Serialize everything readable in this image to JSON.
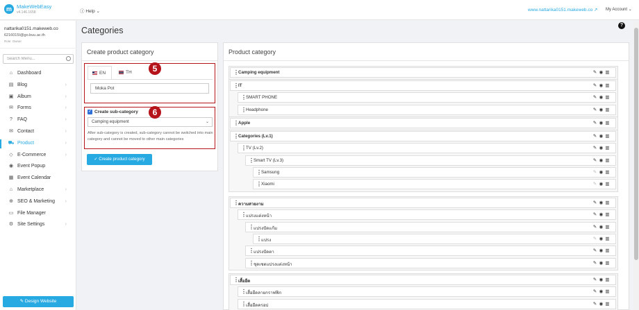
{
  "app": {
    "brand": "MakeWebEasy",
    "version": "v4.146.1658",
    "help": "Help",
    "site_url": "www.nattarika0151.makeweb.co",
    "account": "My Account"
  },
  "user": {
    "site": "nattarika0151.makeweb.co",
    "email": "6216015I@go.buu.ac.th",
    "role": "Role: Owner"
  },
  "sidebar": {
    "search_placeholder": "Search Menu...",
    "items": [
      {
        "label": "Dashboard",
        "icon": "home-icon",
        "glyph": "⌂",
        "chevron": false
      },
      {
        "label": "Blog",
        "icon": "blog-icon",
        "glyph": "▤",
        "chevron": true
      },
      {
        "label": "Album",
        "icon": "album-icon",
        "glyph": "▣",
        "chevron": true
      },
      {
        "label": "Forms",
        "icon": "forms-icon",
        "glyph": "✉",
        "chevron": true
      },
      {
        "label": "FAQ",
        "icon": "faq-icon",
        "glyph": "?",
        "chevron": true
      },
      {
        "label": "Contact",
        "icon": "contact-icon",
        "glyph": "✉",
        "chevron": true
      },
      {
        "label": "Product",
        "icon": "product-icon",
        "glyph": "⛟",
        "chevron": true,
        "active": true
      },
      {
        "label": "E-Commerce",
        "icon": "tag-icon",
        "glyph": "◇",
        "chevron": true
      },
      {
        "label": "Event Popup",
        "icon": "popup-icon",
        "glyph": "◉",
        "chevron": false
      },
      {
        "label": "Event Calendar",
        "icon": "calendar-icon",
        "glyph": "▦",
        "chevron": false
      },
      {
        "label": "Marketplace",
        "icon": "marketplace-icon",
        "glyph": "⌂",
        "chevron": true
      },
      {
        "label": "SEO & Marketing",
        "icon": "seo-icon",
        "glyph": "⊕",
        "chevron": true
      },
      {
        "label": "File Manager",
        "icon": "file-icon",
        "glyph": "▭",
        "chevron": false
      },
      {
        "label": "Site Settings",
        "icon": "gear-icon",
        "glyph": "⚙",
        "chevron": true
      }
    ],
    "design_button": "Design Website"
  },
  "page": {
    "title": "Categories"
  },
  "create_panel": {
    "title": "Create product category",
    "tab_en": "EN",
    "tab_th": "TH",
    "name_value": "Moka Pot",
    "badge_5": "5",
    "badge_6": "6",
    "sub_checkbox_label": "Create sub-category",
    "parent_select_value": "Camping equipment",
    "help_text": "After sub-category is created, sub-category cannot be switched into main category and cannot be moved to other main categories",
    "create_button": "Create product category"
  },
  "category_panel": {
    "title": "Product category",
    "groups": [
      {
        "rows": [
          {
            "label": "Camping equipment",
            "level": 0
          }
        ]
      },
      {
        "rows": [
          {
            "label": "IT",
            "level": 0
          },
          {
            "label": "SMART PHONE",
            "level": 1
          },
          {
            "label": "Headphone",
            "level": 1
          }
        ]
      },
      {
        "rows": [
          {
            "label": "Apple",
            "level": 0
          }
        ]
      },
      {
        "rows": [
          {
            "label": "Categories (Lv.1)",
            "level": 0
          },
          {
            "label": "TV (Lv.2)",
            "level": 1
          },
          {
            "label": "Smart TV (Lv.3)",
            "level": 2
          },
          {
            "label": "Samsung",
            "level": 3,
            "edit_dim": true
          },
          {
            "label": "Xiaomi",
            "level": 3,
            "edit_dim": true
          }
        ]
      },
      {
        "rows": [
          {
            "label": "ความสวยงาม",
            "level": 0
          },
          {
            "label": "แปรงแต่งหน้า",
            "level": 1
          },
          {
            "label": "แปรงปัดแก้ม",
            "level": 2
          },
          {
            "label": "แปรง",
            "level": 3,
            "edit_dim": true
          },
          {
            "label": "แปรงปัดตา",
            "level": 2
          },
          {
            "label": "ชุดเซตแปรงแต่งหน้า",
            "level": 2
          }
        ]
      },
      {
        "rows": [
          {
            "label": "เสื้อยืด",
            "level": 0
          },
          {
            "label": "เสื้อยืดลายกราฟฟิก",
            "level": 1
          },
          {
            "label": "เสื้อยืดครอป",
            "level": 1
          }
        ]
      }
    ]
  }
}
